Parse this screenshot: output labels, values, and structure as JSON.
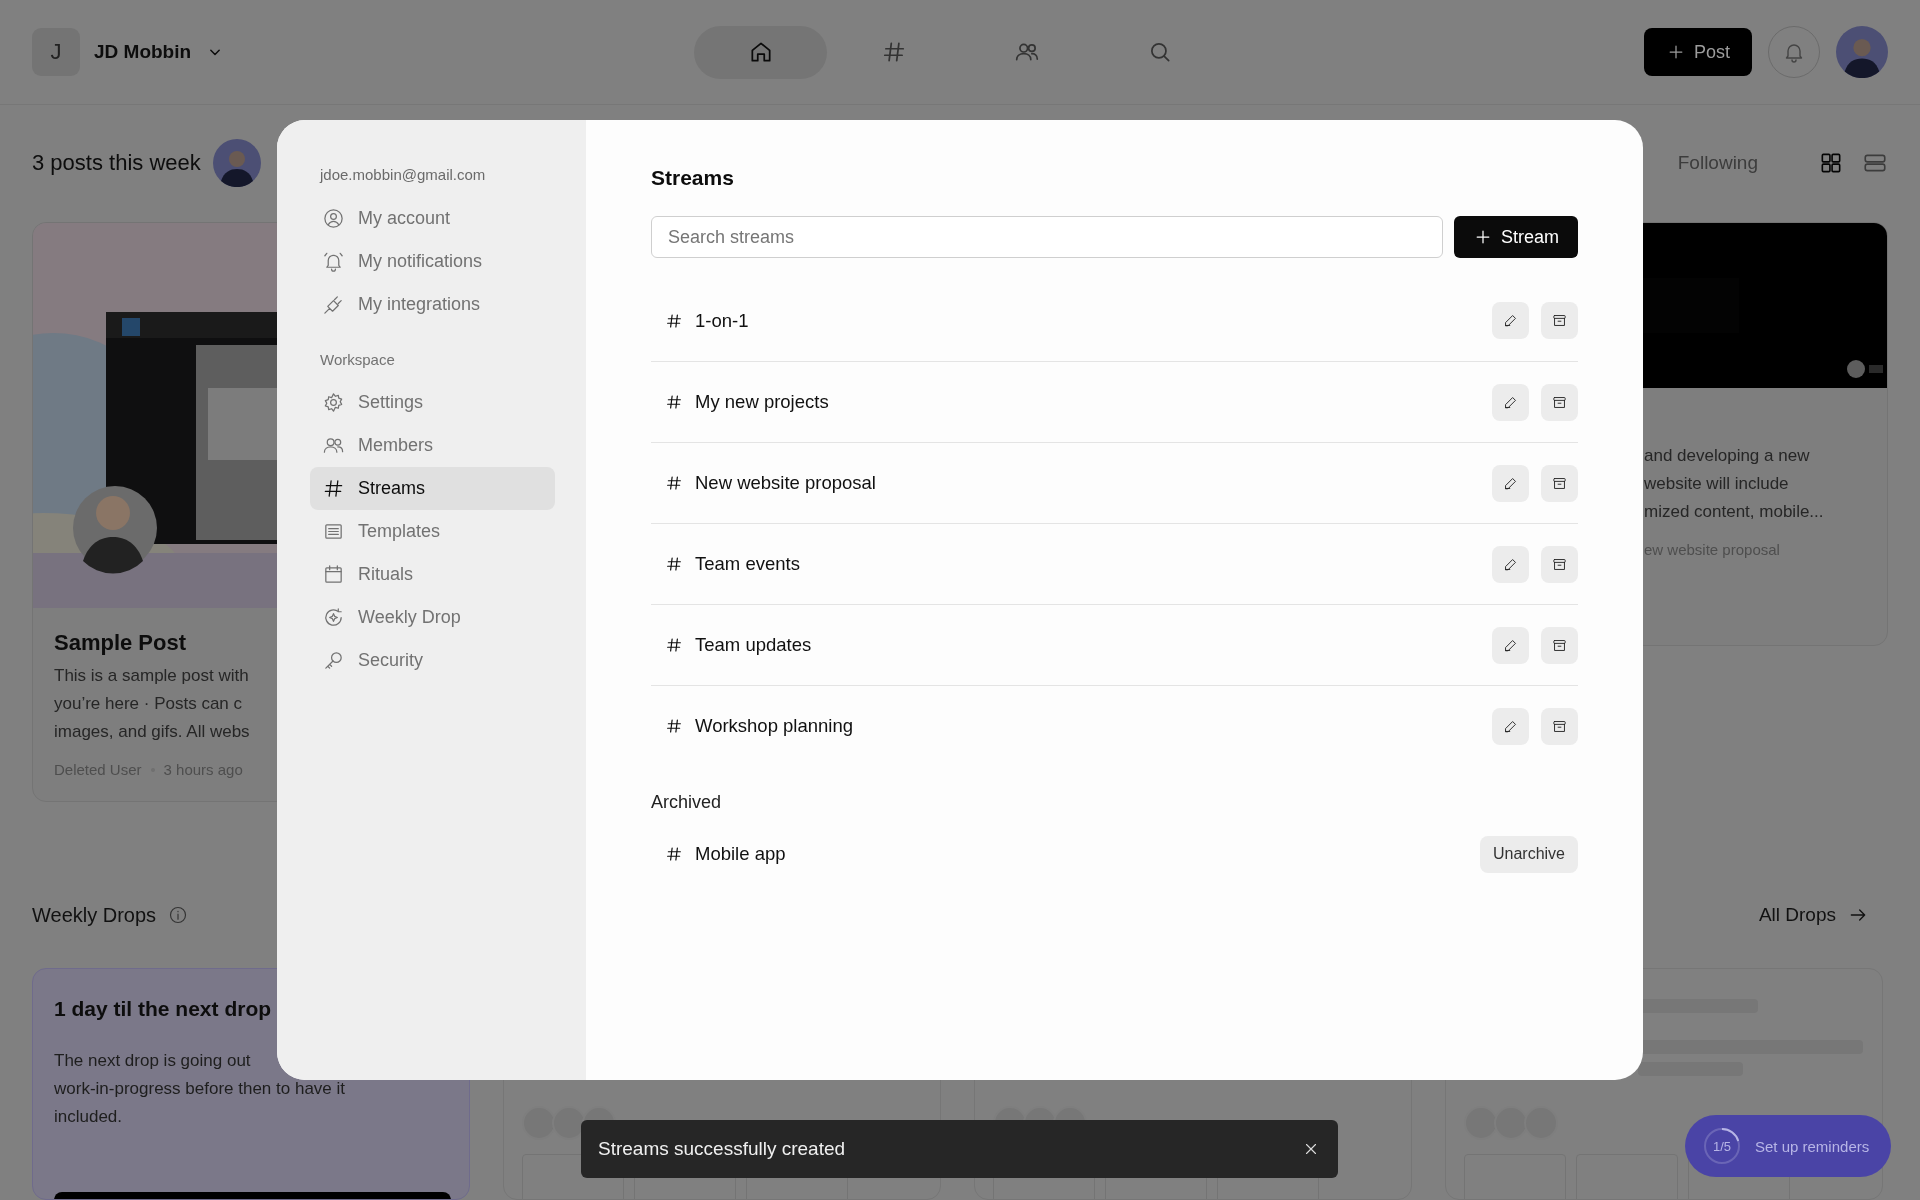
{
  "top_bar": {
    "user_initial": "J",
    "user_name": "JD Mobbin",
    "nav": [
      {
        "kind": "home",
        "selected": true
      },
      {
        "kind": "streams",
        "selected": false
      },
      {
        "kind": "members",
        "selected": false
      },
      {
        "kind": "search",
        "selected": false
      }
    ],
    "post_button": "Post"
  },
  "feed": {
    "summary": "3 posts this week",
    "filter": "Following",
    "views": [
      {
        "kind": "grid",
        "selected": true
      },
      {
        "kind": "list",
        "selected": false
      }
    ],
    "posts": [
      {
        "title": "Sample Post",
        "lines": [
          "This is a sample post with",
          "you’re here · Posts can c",
          "images, and gifs. All webs"
        ],
        "author": "Deleted User",
        "time": "3 hours ago"
      },
      {
        "lines": [
          "and developing a new",
          "website will include",
          "mized content, mobile..."
        ],
        "stream": "ew website proposal"
      }
    ]
  },
  "weekly_drops": {
    "title": "Weekly Drops",
    "link": "All Drops",
    "countdown": {
      "title": "1 day til the next drop",
      "lines": [
        "The next drop is going out",
        "work-in-progress before then to have it",
        "included."
      ]
    }
  },
  "settings_modal": {
    "email": "jdoe.mobbin@gmail.com",
    "account_items": [
      {
        "kind": "account",
        "label": "My account",
        "selected": false
      },
      {
        "kind": "notifications",
        "label": "My notifications",
        "selected": false
      },
      {
        "kind": "integrations",
        "label": "My integrations",
        "selected": false
      }
    ],
    "workspace_heading": "Workspace",
    "workspace_items": [
      {
        "kind": "settings",
        "label": "Settings",
        "selected": false
      },
      {
        "kind": "members",
        "label": "Members",
        "selected": false
      },
      {
        "kind": "streams",
        "label": "Streams",
        "selected": true
      },
      {
        "kind": "templates",
        "label": "Templates",
        "selected": false
      },
      {
        "kind": "rituals",
        "label": "Rituals",
        "selected": false
      },
      {
        "kind": "weekly",
        "label": "Weekly Drop",
        "selected": false
      },
      {
        "kind": "security",
        "label": "Security",
        "selected": false
      }
    ],
    "title": "Streams",
    "search": {
      "placeholder": "Search streams"
    },
    "new_button": "Stream",
    "streams": [
      {
        "name": "1-on-1"
      },
      {
        "name": "My new projects"
      },
      {
        "name": "New website proposal"
      },
      {
        "name": "Team events"
      },
      {
        "name": "Team updates"
      },
      {
        "name": "Workshop planning"
      }
    ],
    "archived_heading": "Archived",
    "archived": [
      {
        "name": "Mobile app",
        "action": "Unarchive"
      }
    ]
  },
  "toast": {
    "message": "Streams successfully created"
  },
  "reminders": {
    "progress": "1/5",
    "label": "Set up reminders",
    "level": 0.2
  }
}
